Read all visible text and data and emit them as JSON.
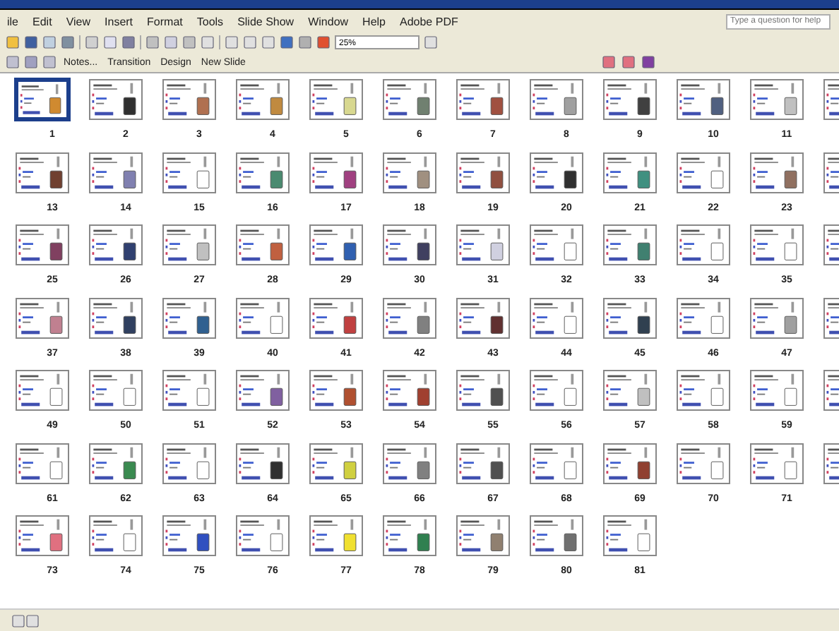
{
  "menu_bar": {
    "items": [
      "ile",
      "Edit",
      "View",
      "Insert",
      "Format",
      "Tools",
      "Slide Show",
      "Window",
      "Help",
      "Adobe PDF"
    ],
    "help_box": {
      "placeholder": "Type a question for help"
    }
  },
  "standard_toolbar": {
    "zoom": "25%"
  },
  "slide_sorter_toolbar": {
    "buttons": [
      "Notes...",
      "Transition",
      "Design",
      "New Slide"
    ]
  },
  "slides": [
    {
      "number": "1",
      "selected": true,
      "color": "#d08a30"
    },
    {
      "number": "2",
      "selected": false,
      "color": "#303030"
    },
    {
      "number": "3",
      "selected": false,
      "color": "#b07050"
    },
    {
      "number": "4",
      "selected": false,
      "color": "#c08a40"
    },
    {
      "number": "5",
      "selected": false,
      "color": "#d8d890"
    },
    {
      "number": "6",
      "selected": false,
      "color": "#708070"
    },
    {
      "number": "7",
      "selected": false,
      "color": "#a05040"
    },
    {
      "number": "8",
      "selected": false,
      "color": "#a0a0a0"
    },
    {
      "number": "9",
      "selected": false,
      "color": "#404040"
    },
    {
      "number": "10",
      "selected": false,
      "color": "#506080"
    },
    {
      "number": "11",
      "selected": false,
      "color": "#c0c0c0"
    },
    {
      "selected": false
    },
    {
      "number": "13",
      "selected": false,
      "color": "#704030"
    },
    {
      "number": "14",
      "selected": false,
      "color": "#8080b0"
    },
    {
      "number": "15",
      "selected": false,
      "color": "#ffffff"
    },
    {
      "number": "16",
      "selected": false,
      "color": "#4a8a70"
    },
    {
      "number": "17",
      "selected": false,
      "color": "#a04080"
    },
    {
      "number": "18",
      "selected": false,
      "color": "#a09080"
    },
    {
      "number": "19",
      "selected": false,
      "color": "#905040"
    },
    {
      "number": "20",
      "selected": false,
      "color": "#303030"
    },
    {
      "number": "21",
      "selected": false,
      "color": "#409080"
    },
    {
      "number": "22",
      "selected": false,
      "color": "#ffffff"
    },
    {
      "number": "23",
      "selected": false,
      "color": "#907060"
    },
    {
      "selected": false
    },
    {
      "number": "25",
      "selected": false,
      "color": "#804060"
    },
    {
      "number": "26",
      "selected": false,
      "color": "#304070"
    },
    {
      "number": "27",
      "selected": false,
      "color": "#c0c0c0"
    },
    {
      "number": "28",
      "selected": false,
      "color": "#c06040"
    },
    {
      "number": "29",
      "selected": false,
      "color": "#3060b0"
    },
    {
      "number": "30",
      "selected": false,
      "color": "#404060"
    },
    {
      "number": "31",
      "selected": false,
      "color": "#d0d0e0"
    },
    {
      "number": "32",
      "selected": false,
      "color": "#ffffff"
    },
    {
      "number": "33",
      "selected": false,
      "color": "#408070"
    },
    {
      "number": "34",
      "selected": false,
      "color": "#ffffff"
    },
    {
      "number": "35",
      "selected": false,
      "color": "#ffffff"
    },
    {
      "selected": false
    },
    {
      "number": "37",
      "selected": false,
      "color": "#c08090"
    },
    {
      "number": "38",
      "selected": false,
      "color": "#304060"
    },
    {
      "number": "39",
      "selected": false,
      "color": "#306090"
    },
    {
      "number": "40",
      "selected": false,
      "color": "#ffffff"
    },
    {
      "number": "41",
      "selected": false,
      "color": "#c04040"
    },
    {
      "number": "42",
      "selected": false,
      "color": "#808080"
    },
    {
      "number": "43",
      "selected": false,
      "color": "#603030"
    },
    {
      "number": "44",
      "selected": false,
      "color": "#ffffff"
    },
    {
      "number": "45",
      "selected": false,
      "color": "#304050"
    },
    {
      "number": "46",
      "selected": false,
      "color": "#ffffff"
    },
    {
      "number": "47",
      "selected": false,
      "color": "#a0a0a0"
    },
    {
      "selected": false
    },
    {
      "number": "49",
      "selected": false,
      "color": "#ffffff"
    },
    {
      "number": "50",
      "selected": false,
      "color": "#ffffff"
    },
    {
      "number": "51",
      "selected": false,
      "color": "#ffffff"
    },
    {
      "number": "52",
      "selected": false,
      "color": "#8060a0"
    },
    {
      "number": "53",
      "selected": false,
      "color": "#b05030"
    },
    {
      "number": "54",
      "selected": false,
      "color": "#a04030"
    },
    {
      "number": "55",
      "selected": false,
      "color": "#505050"
    },
    {
      "number": "56",
      "selected": false,
      "color": "#ffffff"
    },
    {
      "number": "57",
      "selected": false,
      "color": "#c0c0c0"
    },
    {
      "number": "58",
      "selected": false,
      "color": "#ffffff"
    },
    {
      "number": "59",
      "selected": false,
      "color": "#ffffff"
    },
    {
      "selected": false
    },
    {
      "number": "61",
      "selected": false,
      "color": "#ffffff"
    },
    {
      "number": "62",
      "selected": false,
      "color": "#3a8a50"
    },
    {
      "number": "63",
      "selected": false,
      "color": "#ffffff"
    },
    {
      "number": "64",
      "selected": false,
      "color": "#303030"
    },
    {
      "number": "65",
      "selected": false,
      "color": "#d0d040"
    },
    {
      "number": "66",
      "selected": false,
      "color": "#808080"
    },
    {
      "number": "67",
      "selected": false,
      "color": "#505050"
    },
    {
      "number": "68",
      "selected": false,
      "color": "#ffffff"
    },
    {
      "number": "69",
      "selected": false,
      "color": "#904030"
    },
    {
      "number": "70",
      "selected": false,
      "color": "#ffffff"
    },
    {
      "number": "71",
      "selected": false,
      "color": "#ffffff"
    },
    {
      "selected": false
    },
    {
      "number": "73",
      "selected": false,
      "color": "#e07080"
    },
    {
      "number": "74",
      "selected": false,
      "color": "#ffffff"
    },
    {
      "number": "75",
      "selected": false,
      "color": "#3050c0"
    },
    {
      "number": "76",
      "selected": false,
      "color": "#ffffff"
    },
    {
      "number": "77",
      "selected": false,
      "color": "#f0e030"
    },
    {
      "number": "78",
      "selected": false,
      "color": "#308050"
    },
    {
      "number": "79",
      "selected": false,
      "color": "#908070"
    },
    {
      "number": "80",
      "selected": false,
      "color": "#707070"
    },
    {
      "number": "81",
      "selected": false,
      "color": "#ffffff"
    }
  ]
}
